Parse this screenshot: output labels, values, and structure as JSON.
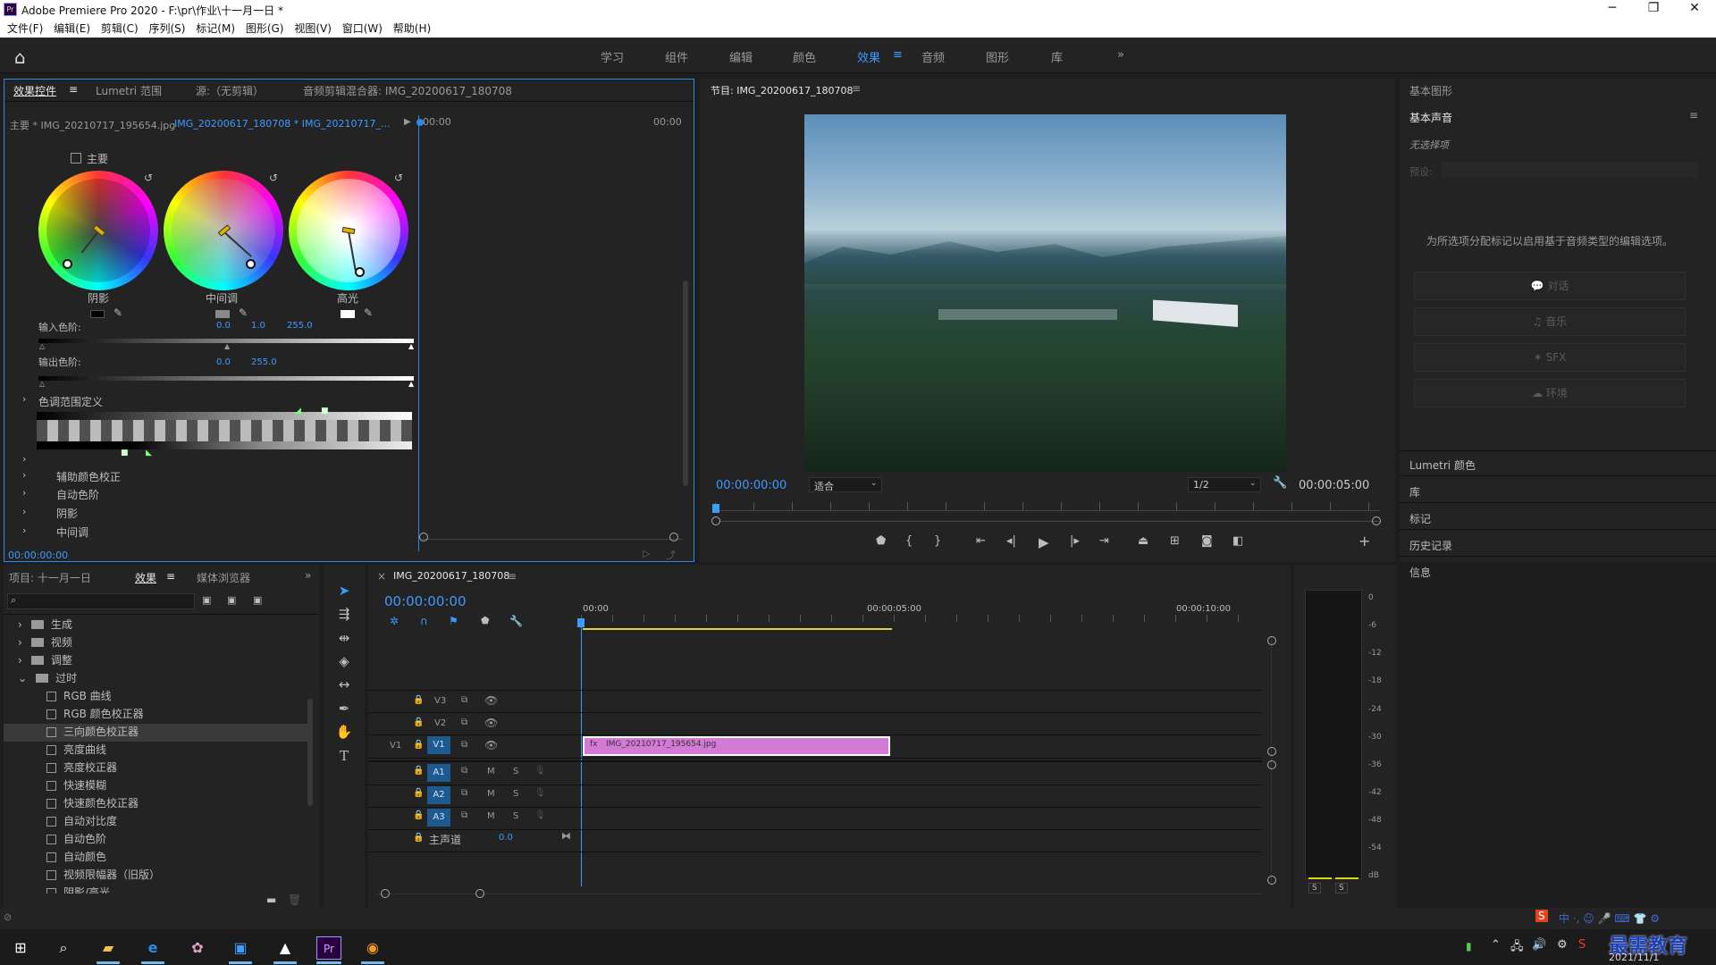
{
  "window": {
    "title": "Adobe Premiere Pro 2020 - F:\\pr\\作业\\十一月一日 *",
    "minimize": "─",
    "restore": "❐",
    "close": "✕"
  },
  "menu": [
    "文件(F)",
    "编辑(E)",
    "剪辑(C)",
    "序列(S)",
    "标记(M)",
    "图形(G)",
    "视图(V)",
    "窗口(W)",
    "帮助(H)"
  ],
  "workspaces": [
    "学习",
    "组件",
    "编辑",
    "颜色",
    "效果",
    "音频",
    "图形",
    "库"
  ],
  "workspace_active": "效果",
  "workspace_more": "»",
  "effect_controls": {
    "tabs": [
      "效果控件",
      "Lumetri 范围",
      "源:（无剪辑）",
      "音频剪辑混合器: IMG_20200617_180708"
    ],
    "tab_menu": "≡",
    "master_clip": "主要 * IMG_20210717_195654.jpg",
    "sequence_clip": "IMG_20200617_180708 * IMG_20210717_...",
    "time_start": "00:00",
    "time_end": "00:00",
    "master_checkbox": "主要",
    "wheels": [
      {
        "label": "阴影"
      },
      {
        "label": "中间调"
      },
      {
        "label": "高光"
      }
    ],
    "input_levels_label": "输入色阶:",
    "input_values": [
      "0.0",
      "1.0",
      "255.0"
    ],
    "output_levels_label": "输出色阶:",
    "output_values": [
      "0.0",
      "255.0"
    ],
    "tonal_range": "色调范围定义",
    "sections": [
      "辅助颜色校正",
      "自动色阶",
      "阴影",
      "中间调"
    ],
    "current_time": "00:00:00:00"
  },
  "program": {
    "title": "节目: IMG_20200617_180708",
    "menu": "≡",
    "timecode": "00:00:00:00",
    "fit": "适合",
    "resolution": "1/2",
    "duration": "00:00:05:00"
  },
  "right_panel": {
    "essential_graphics": "基本图形",
    "essential_sound": "基本声音",
    "menu": "≡",
    "no_selection": "无选择项",
    "preset_label": "预设:",
    "hint": "为所选项分配标记以启用基于音频类型的编辑选项。",
    "buttons": [
      "对话",
      "音乐",
      "SFX",
      "环境"
    ],
    "links": [
      "Lumetri 颜色",
      "库",
      "标记",
      "历史记录",
      "信息"
    ]
  },
  "project": {
    "tabs": [
      "项目: 十一月一日",
      "效果",
      "媒体浏览器"
    ],
    "more": "»",
    "folders": [
      "生成",
      "视频",
      "调整",
      "过时"
    ],
    "effects": [
      "RGB 曲线",
      "RGB 颜色校正器",
      "三向颜色校正器",
      "亮度曲线",
      "亮度校正器",
      "快速模糊",
      "快速颜色校正器",
      "自动对比度",
      "自动色阶",
      "自动颜色",
      "视频限幅器（旧版）",
      "阴影/高光"
    ],
    "selected_effect": "三向颜色校正器"
  },
  "timeline": {
    "close": "×",
    "title": "IMG_20200617_180708",
    "menu": "≡",
    "timecode": "00:00:00:00",
    "ruler": [
      "00:00",
      "00:00:05:00",
      "00:00:10:00"
    ],
    "video_tracks": [
      "V3",
      "V2",
      "V1"
    ],
    "source_track": "V1",
    "audio_tracks": [
      "A1",
      "A2",
      "A3"
    ],
    "mute": "M",
    "solo": "S",
    "master": "主声道",
    "master_value": "0.0",
    "clip_name": "IMG_20210717_195654.jpg"
  },
  "audio_meter": {
    "scale": [
      "0",
      "-6",
      "-12",
      "-18",
      "-24",
      "-30",
      "-36",
      "-42",
      "-48",
      "-54",
      "dB"
    ],
    "solo_left": "S",
    "solo_right": "S"
  },
  "taskbar": {
    "tray": "中 ·, ☺ 🎤 ⌨ 👕 ⚙",
    "date": "2021/11/1",
    "watermark": "最需教育"
  },
  "colors": {
    "accent": "#3d9bff",
    "clip": "#d47ad6",
    "playhead": "#3d9bff"
  }
}
